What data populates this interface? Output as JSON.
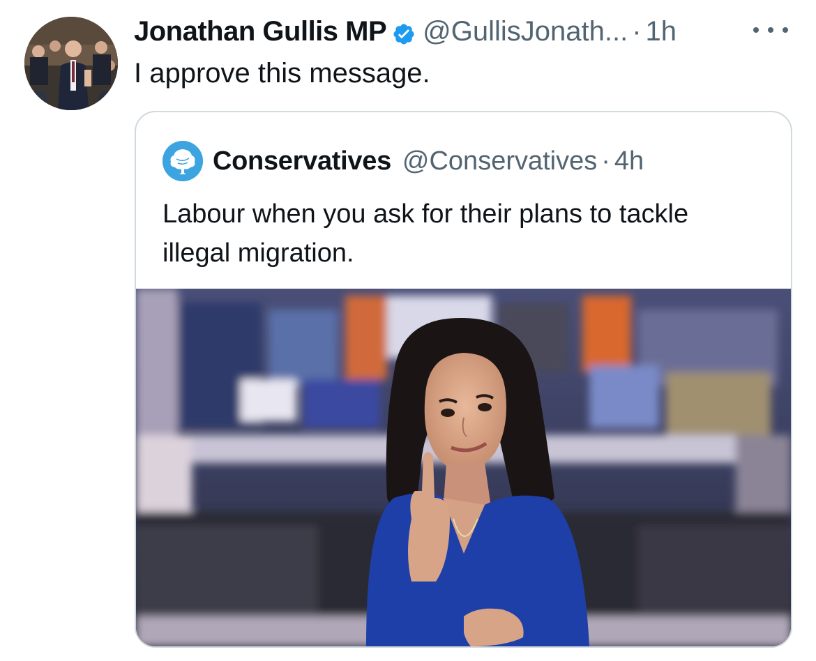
{
  "tweet": {
    "display_name": "Jonathan Gullis MP",
    "handle": "@GullisJonath...",
    "separator": "·",
    "time": "1h",
    "text": "I approve this message.",
    "avatar_icon": "profile-photo",
    "verified_icon": "verified-badge-icon",
    "more_icon": "more-options-icon"
  },
  "quoted": {
    "display_name": "Conservatives",
    "handle": "@Conservatives",
    "separator": "·",
    "time": "4h",
    "text": "Labour when you ask for their plans to tackle illegal migration.",
    "avatar_icon": "conservatives-tree-logo",
    "media_icon": "news-presenter-photo"
  },
  "colors": {
    "verified": "#1d9bf0",
    "secondary_text": "#536471",
    "border": "#cfd9de",
    "conservatives_blue": "#3ca4e0"
  }
}
